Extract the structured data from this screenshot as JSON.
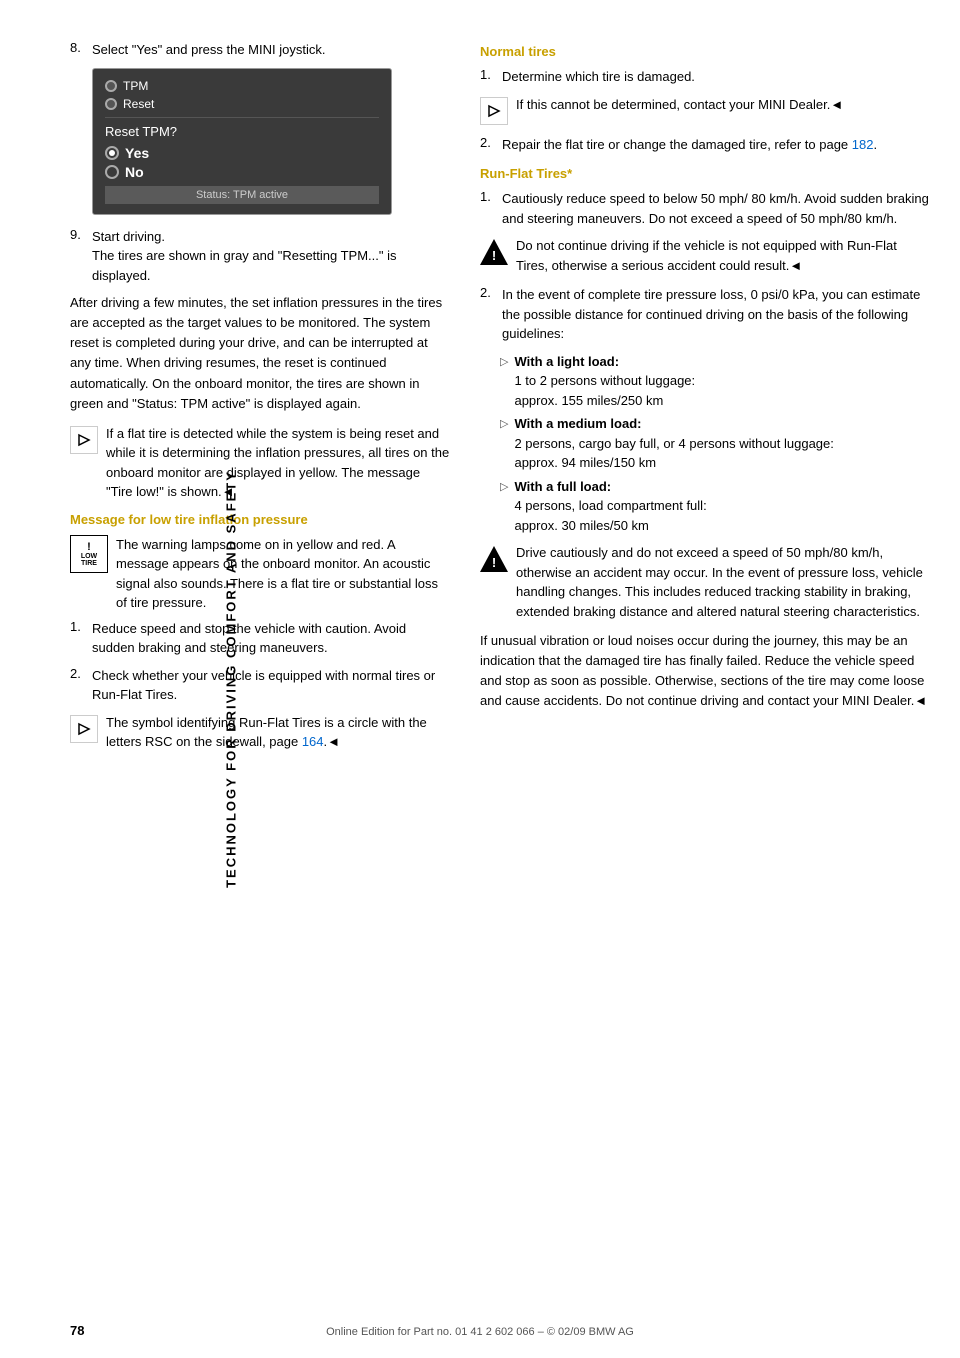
{
  "sidebar": {
    "label": "TECHNOLOGY FOR DRIVING COMFORT AND SAFETY"
  },
  "page": {
    "number": "78",
    "footer": "Online Edition for Part no. 01 41 2 602 066 – © 02/09 BMW AG"
  },
  "screen": {
    "item1": "TPM",
    "item2": "Reset",
    "question": "Reset TPM?",
    "option_yes": "Yes",
    "option_no": "No",
    "status": "Status: TPM active"
  },
  "left_column": {
    "step8": {
      "num": "8.",
      "text": "Select \"Yes\" and press the MINI joystick."
    },
    "step9": {
      "num": "9.",
      "line1": "Start driving.",
      "line2": "The tires are shown in gray and \"Resetting TPM...\" is displayed."
    },
    "para1": "After driving a few minutes, the set inflation pressures in the tires are accepted as the target values to be monitored. The system reset is completed during your drive, and can be interrupted at any time. When driving resumes, the reset is continued automatically. On the onboard monitor, the tires are shown in green and \"Status: TPM active\" is displayed again.",
    "note1": "If a flat tire is detected while the system is being reset and while it is determining the inflation pressures, all tires on the onboard monitor are displayed in yellow. The message \"Tire low!\" is shown.◄",
    "section_heading": "Message for low tire inflation pressure",
    "tire_note": "The warning lamps come on in yellow and red. A message appears on the onboard monitor. An acoustic signal also sounds. There is a flat tire or substantial loss of tire pressure.",
    "step1": {
      "num": "1.",
      "text": "Reduce speed and stop the vehicle with caution. Avoid sudden braking and steering maneuvers."
    },
    "step2": {
      "num": "2.",
      "text": "Check whether your vehicle is equipped with normal tires or Run-Flat Tires."
    },
    "note2": "The symbol identifying Run-Flat Tires is a circle with the letters RSC on the sidewall, page 164.◄"
  },
  "right_column": {
    "normal_tires_heading": "Normal tires",
    "normal_step1": {
      "num": "1.",
      "text": "Determine which tire is damaged."
    },
    "normal_note1": "If this cannot be determined, contact your MINI Dealer.◄",
    "normal_step2": {
      "num": "2.",
      "text": "Repair the flat tire or change the damaged tire, refer to page 182."
    },
    "page182": "182",
    "runflat_heading": "Run-Flat Tires*",
    "runflat_step1": {
      "num": "1.",
      "text": "Cautiously reduce speed to below 50 mph/ 80 km/h. Avoid sudden braking and steering maneuvers. Do not exceed a speed of 50 mph/80 km/h."
    },
    "runflat_warning": "Do not continue driving if the vehicle is not equipped with Run-Flat Tires, otherwise a serious accident could result.◄",
    "runflat_step2": {
      "num": "2.",
      "text": "In the event of complete tire pressure loss, 0 psi/0 kPa, you can estimate the possible distance for continued driving on the basis of the following guidelines:"
    },
    "bullets": [
      {
        "label": "With a light load:",
        "text": "1 to 2 persons without luggage:\napprox. 155 miles/250 km"
      },
      {
        "label": "With a medium load:",
        "text": "2 persons, cargo bay full, or 4 persons without luggage:\napprox. 94 miles/150 km"
      },
      {
        "label": "With a full load:",
        "text": "4 persons, load compartment full:\napprox. 30 miles/50 km"
      }
    ],
    "drive_warning": "Drive cautiously and do not exceed a speed of 50 mph/80 km/h, otherwise an accident may occur. In the event of pressure loss, vehicle handling changes. This includes reduced tracking stability in braking, extended braking distance and altered natural steering characteristics.",
    "final_para": "If unusual vibration or loud noises occur during the journey, this may be an indication that the damaged tire has finally failed. Reduce the vehicle speed and stop as soon as possible. Otherwise, sections of the tire may come loose and cause accidents. Do not continue driving and contact your MINI Dealer.◄"
  }
}
